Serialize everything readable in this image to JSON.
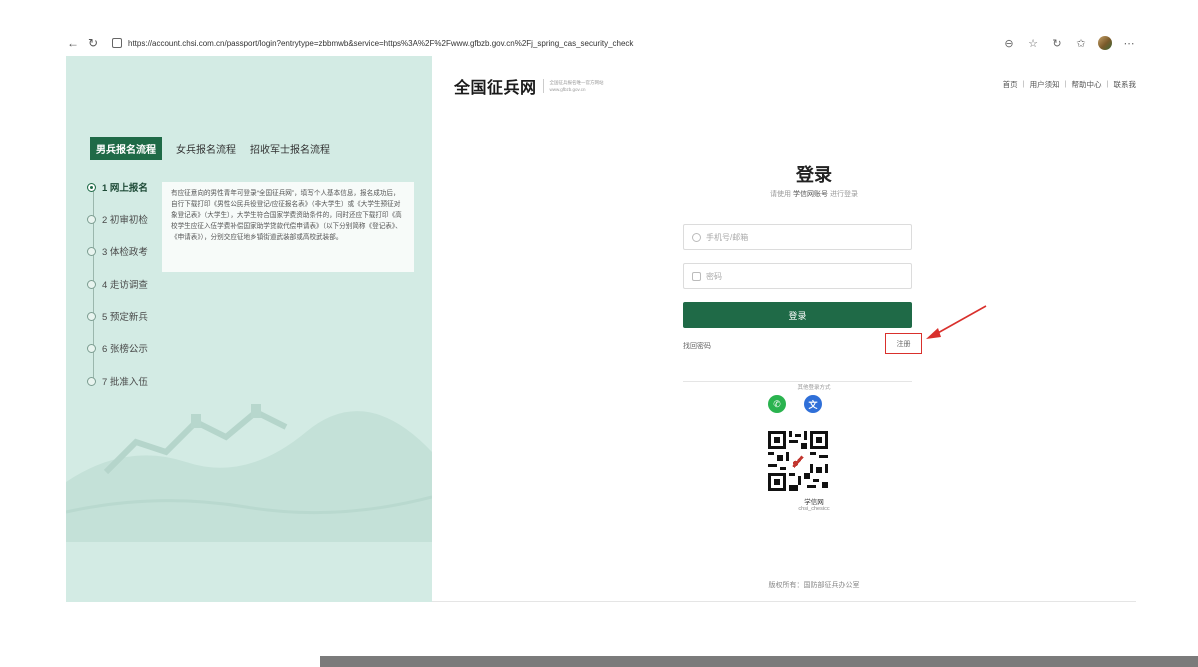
{
  "browser": {
    "url": "https://account.chsi.com.cn/passport/login?entrytype=zbbmwb&service=https%3A%2F%2Fwww.gfbzb.gov.cn%2Fj_spring_cas_security_check"
  },
  "left": {
    "tabs": [
      "男兵报名流程",
      "女兵报名流程",
      "招收军士报名流程"
    ],
    "steps": [
      "1 网上报名",
      "2 初审初检",
      "3 体检政考",
      "4 走访调查",
      "5 预定新兵",
      "6 张榜公示",
      "7 批准入伍"
    ],
    "description": "有应征意向的男性青年可登录“全国征兵网”，填写个人基本信息，报名成功后，自行下载打印《男性公民兵役登记/应征报名表》（非大学生）或《大学生预征对象登记表》（大学生），大学生符合国家学费资助条件的，同时还应下载打印《高校学生应征入伍学费补偿国家助学贷款代偿申请表》（以下分别简称《登记表》、《申请表》），分别交应征地乡镇街道武装部或高校武装部。"
  },
  "header": {
    "logo_title": "全国征兵网",
    "logo_sub_line1": "全国征兵报名唯一官方网站",
    "logo_sub_line2": "www.gfbzb.gov.cn",
    "nav": [
      "首页",
      "用户须知",
      "帮助中心",
      "联系我"
    ]
  },
  "login": {
    "title": "登录",
    "hint_prefix": "请使用",
    "hint_bold": "学信网账号",
    "hint_suffix": "进行登录",
    "username_placeholder": "手机号/邮箱",
    "password_placeholder": "密码",
    "submit": "登录",
    "forgot": "找回密码",
    "register": "注册",
    "other_methods": "其他登录方式",
    "wechat_glyph": "✆",
    "chsi_glyph": "文",
    "qr_label": "学信网",
    "qr_sub": "chsi_chesicc",
    "footer": "版权所有：国防部征兵办公室"
  },
  "colors": {
    "primary": "#1f6a47",
    "panel_bg": "#d3ebe4",
    "annotation": "#d9302c"
  }
}
